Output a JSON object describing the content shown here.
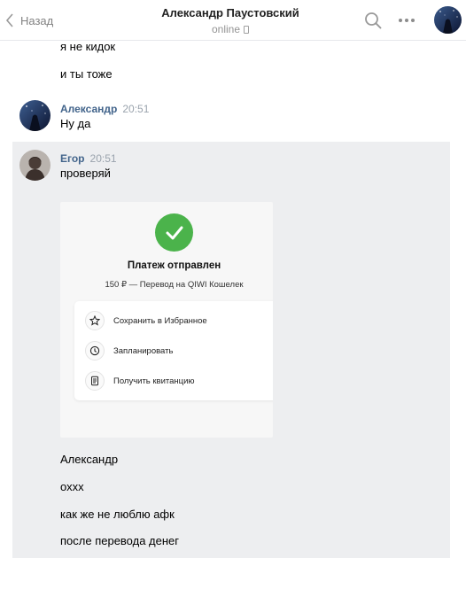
{
  "header": {
    "back_label": "Назад",
    "title": "Александр Паустовский",
    "status": "online"
  },
  "messages_top": [
    "я не кидок",
    "и ты тоже"
  ],
  "alex_msg": {
    "author": "Александр",
    "time": "20:51",
    "text": "Ну да"
  },
  "egor_msg": {
    "author": "Егор",
    "time": "20:51",
    "text": "проверяй"
  },
  "receipt": {
    "title": "Платеж отправлен",
    "subtitle": "150 ₽ — Перевод на QIWI Кошелек",
    "items": [
      {
        "label": "Сохранить в Избранное",
        "icon": "star-icon"
      },
      {
        "label": "Запланировать",
        "icon": "clock-icon"
      },
      {
        "label": "Получить квитанцию",
        "icon": "receipt-icon"
      }
    ]
  },
  "messages_bottom": [
    "Александр",
    "оххх",
    "как же не люблю афк",
    "после перевода денег"
  ],
  "colors": {
    "author": "#42648b",
    "selected_bg": "#edeef0",
    "success": "#4bb34b"
  }
}
